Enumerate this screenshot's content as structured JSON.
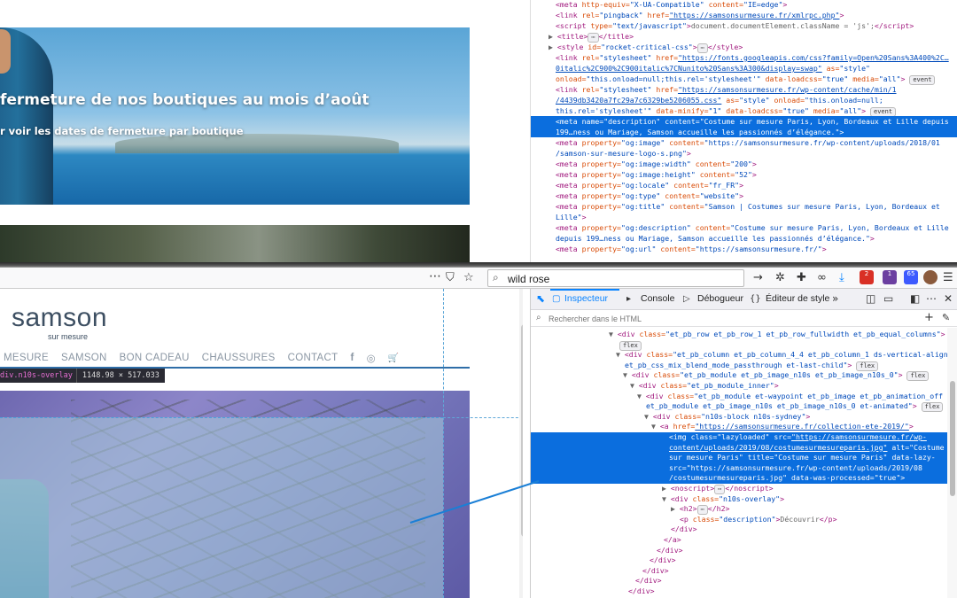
{
  "top_page": {
    "hero_title": "fermeture de nos boutiques au mois d’août",
    "hero_subtitle": "r voir les dates de fermeture par boutique"
  },
  "top_source": [
    {
      "html": "<span class='tag'>&lt;meta</span> <span class='attr'>http-equiv=</span><span class='val'>\"X-UA-Compatible\"</span> <span class='attr'>content=</span><span class='val'>\"IE=edge\"</span><span class='tag'>&gt;</span>",
      "indent": 28
    },
    {
      "html": "<span class='tag'>&lt;link</span> <span class='attr'>rel=</span><span class='val'>\"pingback\"</span> <span class='attr'>href=</span><span class='lnk'>\"https://samsonsurmesure.fr/xmlrpc.php\"</span><span class='tag'>&gt;</span>",
      "indent": 28
    },
    {
      "html": "<span class='tag'>&lt;script</span> <span class='attr'>type=</span><span class='val'>\"text/javascript\"</span><span class='tag'>&gt;</span>document.documentElement.className = 'js';<span class='tag'>&lt;/script&gt;</span>",
      "indent": 28
    },
    {
      "html": "▶ <span class='tag'>&lt;title&gt;</span><span class='badge'>⋯</span><span class='tag'>&lt;/title&gt;</span>",
      "indent": 20
    },
    {
      "html": "▶ <span class='tag'>&lt;style</span> <span class='attr'>id=</span><span class='val'>\"rocket-critical-css\"</span><span class='tag'>&gt;</span><span class='badge'>⋯</span><span class='tag'>&lt;/style&gt;</span>",
      "indent": 20
    },
    {
      "html": "<span class='tag'>&lt;link</span> <span class='attr'>rel=</span><span class='val'>\"stylesheet\"</span> <span class='attr'>href=</span><span class='lnk'>\"https://fonts.googleapis.com/css?family=Open%20Sans%3A400%2C…</span>",
      "indent": 28
    },
    {
      "html": "<span class='lnk'>0italic%2C900%2C900italic%7CNunito%20Sans%3A300&amp;display=swap\"</span> <span class='attr'>as=</span><span class='val'>\"style\"</span>",
      "indent": 28
    },
    {
      "html": "<span class='attr'>onload=</span><span class='val'>\"this.onload=null;this.rel='stylesheet'\"</span> <span class='attr'>data-loadcss=</span><span class='val'>\"true\"</span> <span class='attr'>media=</span><span class='val'>\"all\"</span><span class='tag'>&gt;</span> <span class='badge'>event</span>",
      "indent": 28
    },
    {
      "html": "<span class='tag'>&lt;link</span> <span class='attr'>rel=</span><span class='val'>\"stylesheet\"</span> <span class='attr'>href=</span><span class='lnk'>\"https://samsonsurmesure.fr/wp-content/cache/min/1</span>",
      "indent": 28
    },
    {
      "html": "<span class='lnk'>/4439db3420a7fc29a7c6329be5206055.css\"</span> <span class='attr'>as=</span><span class='val'>\"style\"</span> <span class='attr'>onload=</span><span class='val'>\"this.onload=null;</span>",
      "indent": 28
    },
    {
      "html": "<span class='val'>this.rel='stylesheet'\"</span> <span class='attr'>data-minify=</span><span class='val'>\"1\"</span> <span class='attr'>data-loadcss=</span><span class='val'>\"true\"</span> <span class='attr'>media=</span><span class='val'>\"all\"</span><span class='tag'>&gt;</span> <span class='badge'>event</span>",
      "indent": 28
    },
    {
      "html": "<span class='tag'>&lt;meta</span> <span class='attr'>name=</span><span class='val'>\"description\"</span> <span class='attr'>content=</span><span class='val'>\"Costume sur mesure Paris, Lyon, Bordeaux et Lille depuis</span>",
      "indent": 28,
      "sel": true
    },
    {
      "html": "<span class='val'>199…ness ou Mariage, Samson accueille les passionnés d’élégance.\"</span><span class='tag'>&gt;</span>",
      "indent": 28,
      "sel": true
    },
    {
      "html": "<span class='tag'>&lt;meta</span> <span class='attr'>property=</span><span class='val'>\"og:image\"</span> <span class='attr'>content=</span><span class='val'>\"https://samsonsurmesure.fr/wp-content/uploads/2018/01</span>",
      "indent": 28
    },
    {
      "html": "<span class='val'>/samson-sur-mesure-logo-s.png\"</span><span class='tag'>&gt;</span>",
      "indent": 28
    },
    {
      "html": "<span class='tag'>&lt;meta</span> <span class='attr'>property=</span><span class='val'>\"og:image:width\"</span> <span class='attr'>content=</span><span class='val'>\"200\"</span><span class='tag'>&gt;</span>",
      "indent": 28
    },
    {
      "html": "<span class='tag'>&lt;meta</span> <span class='attr'>property=</span><span class='val'>\"og:image:height\"</span> <span class='attr'>content=</span><span class='val'>\"52\"</span><span class='tag'>&gt;</span>",
      "indent": 28
    },
    {
      "html": "<span class='tag'>&lt;meta</span> <span class='attr'>property=</span><span class='val'>\"og:locale\"</span> <span class='attr'>content=</span><span class='val'>\"fr_FR\"</span><span class='tag'>&gt;</span>",
      "indent": 28
    },
    {
      "html": "<span class='tag'>&lt;meta</span> <span class='attr'>property=</span><span class='val'>\"og:type\"</span> <span class='attr'>content=</span><span class='val'>\"website\"</span><span class='tag'>&gt;</span>",
      "indent": 28
    },
    {
      "html": "<span class='tag'>&lt;meta</span> <span class='attr'>property=</span><span class='val'>\"og:title\"</span> <span class='attr'>content=</span><span class='val'>\"Samson | Costumes sur mesure Paris, Lyon, Bordeaux et</span>",
      "indent": 28
    },
    {
      "html": "<span class='val'>Lille\"</span><span class='tag'>&gt;</span>",
      "indent": 28
    },
    {
      "html": "<span class='tag'>&lt;meta</span> <span class='attr'>property=</span><span class='val'>\"og:description\"</span> <span class='attr'>content=</span><span class='val'>\"Costume sur mesure Paris, Lyon, Bordeaux et Lille</span>",
      "indent": 28
    },
    {
      "html": "<span class='val'>depuis 199…ness ou Mariage, Samson accueille les passionnés d’élégance.\"</span><span class='tag'>&gt;</span>",
      "indent": 28
    },
    {
      "html": "<span class='tag'>&lt;meta</span> <span class='attr'>property=</span><span class='val'>\"og:url\"</span> <span class='attr'>content=</span><span class='val'>\"https://samsonsurmesure.fr/\"</span><span class='tag'>&gt;</span>",
      "indent": 28
    }
  ],
  "toolbar": {
    "more": "⋯",
    "pocket": "⛉",
    "star": "☆",
    "search_value": "wild rose",
    "arrow": "→",
    "addon_badges": [
      "2",
      "1",
      "65"
    ]
  },
  "page": {
    "logo": "samson",
    "logo_sub": "sur mesure",
    "nav": [
      "MESURE",
      "SAMSON",
      "BON CADEAU",
      "CHAUSSURES",
      "CONTACT"
    ],
    "nav_icons": [
      "f",
      "◎",
      "🛒"
    ],
    "tooltip_name": "div.n10s-overlay",
    "tooltip_size": "1148.98 × 517.033"
  },
  "devtools": {
    "tabs": [
      "Inspecteur",
      "Console",
      "Débogueur",
      "Éditeur de style"
    ],
    "active_tab": "Inspecteur",
    "search_placeholder": "Rechercher dans le HTML",
    "tree": [
      {
        "html": "▼ <span class='tag'>&lt;div</span> <span class='attr'>class=</span><span class='val'>\"et_pb_row et_pb_row_1 et_pb_row_fullwidth et_pb_equal_columns\"</span><span class='tag'>&gt;</span>",
        "indent": 88
      },
      {
        "html": "<span class='badge'>flex</span>",
        "indent": 100
      },
      {
        "html": "▼ <span class='tag'>&lt;div</span> <span class='attr'>class=</span><span class='val'>\"et_pb_column et_pb_column_4_4 et_pb_column_1 ds-vertical-align</span>",
        "indent": 96
      },
      {
        "html": "<span class='val'>et_pb_css_mix_blend_mode_passthrough et-last-child\"</span><span class='tag'>&gt;</span> <span class='badge'>flex</span>",
        "indent": 106
      },
      {
        "html": "▼ <span class='tag'>&lt;div</span> <span class='attr'>class=</span><span class='val'>\"et_pb_module et_pb_image_n10s et_pb_image_n10s_0\"</span><span class='tag'>&gt;</span> <span class='badge'>flex</span>",
        "indent": 104
      },
      {
        "html": "▼ <span class='tag'>&lt;div</span> <span class='attr'>class=</span><span class='val'>\"et_pb_module_inner\"</span><span class='tag'>&gt;</span>",
        "indent": 112
      },
      {
        "html": "▼ <span class='tag'>&lt;div</span> <span class='attr'>class=</span><span class='val'>\"et_pb_module et-waypoint et_pb_image et_pb_animation_off</span>",
        "indent": 120
      },
      {
        "html": "<span class='val'>et_pb_module et_pb_image_n10s et_pb_image_n10s_0 et-animated\"</span><span class='tag'>&gt;</span> <span class='badge'>flex</span>",
        "indent": 130
      },
      {
        "html": "▼ <span class='tag'>&lt;div</span> <span class='attr'>class=</span><span class='val'>\"n10s-block n10s-sydney\"</span><span class='tag'>&gt;</span>",
        "indent": 128
      },
      {
        "html": "▼ <span class='tag'>&lt;a</span> <span class='attr'>href=</span><span class='lnk'>\"https://samsonsurmesure.fr/collection-ete-2019/\"</span><span class='tag'>&gt;</span>",
        "indent": 136
      },
      {
        "html": "<span class='tag'>&lt;img</span> <span class='attr'>class=</span><span class='val'>\"lazyloaded\"</span> <span class='attr'>src=</span><span class='lnk'>\"https://samsonsurmesure.fr/wp-</span>",
        "indent": 156,
        "sel": true
      },
      {
        "html": "<span class='lnk'>content/uploads/2019/08/costumesurmesureparis.jpg\"</span> <span class='attr'>alt=</span><span class='val'>\"Costume</span>",
        "indent": 156,
        "sel": true
      },
      {
        "html": "<span class='val'>sur mesure Paris\"</span> <span class='attr'>title=</span><span class='val'>\"Costume sur mesure Paris\"</span> <span class='attr'>data-lazy-</span>",
        "indent": 156,
        "sel": true
      },
      {
        "html": "<span class='attr'>src=</span><span class='val'>\"https://samsonsurmesure.fr/wp-content/uploads/2019/08</span>",
        "indent": 156,
        "sel": true
      },
      {
        "html": "<span class='val'>/costumesurmesureparis.jpg\"</span> <span class='attr'>data-was-processed=</span><span class='val'>\"true\"</span><span class='tag'>&gt;</span>",
        "indent": 156,
        "sel": true
      },
      {
        "html": "▶ <span class='tag'>&lt;noscript&gt;</span><span class='badge'>⋯</span><span class='tag'>&lt;/noscript&gt;</span>",
        "indent": 148
      },
      {
        "html": "▼ <span class='tag'>&lt;div</span> <span class='attr'>class=</span><span class='val'>\"n10s-overlay\"</span><span class='tag'>&gt;</span>",
        "indent": 148
      },
      {
        "html": "▶ <span class='tag'>&lt;h2&gt;</span><span class='badge'>⋯</span><span class='tag'>&lt;/h2&gt;</span>",
        "indent": 158
      },
      {
        "html": "<span class='tag'>&lt;p</span> <span class='attr'>class=</span><span class='val'>\"description\"</span><span class='tag'>&gt;</span>Découvrir<span class='tag'>&lt;/p&gt;</span>",
        "indent": 168
      },
      {
        "html": "<span class='tag'>&lt;/div&gt;</span>",
        "indent": 158
      },
      {
        "html": "<span class='tag'>&lt;/a&gt;</span>",
        "indent": 150
      },
      {
        "html": "<span class='tag'>&lt;/div&gt;</span>",
        "indent": 142
      },
      {
        "html": "<span class='tag'>&lt;/div&gt;</span>",
        "indent": 134
      },
      {
        "html": "<span class='tag'>&lt;/div&gt;</span>",
        "indent": 126
      },
      {
        "html": "<span class='tag'>&lt;/div&gt;</span>",
        "indent": 118
      },
      {
        "html": "<span class='tag'>&lt;/div&gt;</span>",
        "indent": 110
      }
    ]
  },
  "colors": {
    "selection": "#0b6ede",
    "accent": "#0a84ff",
    "nav_line": "#2f6ea8",
    "overlay_purple": "#7a7bbf"
  }
}
